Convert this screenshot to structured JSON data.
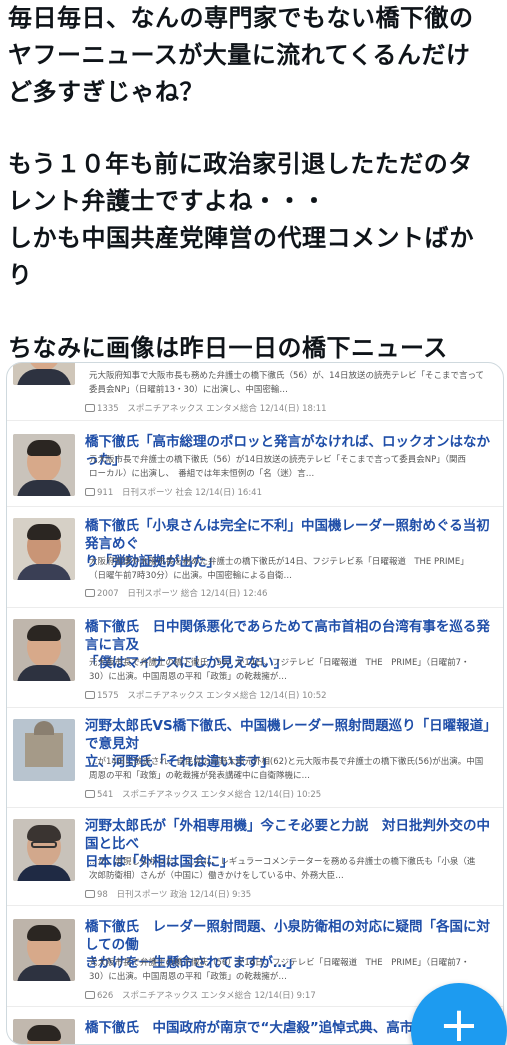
{
  "post": {
    "paragraphs": [
      [
        "毎日毎日、なんの専門家でもない橋下徹の",
        "ヤフーニュースが大量に流れてくるんだけ",
        "ど多すぎじゃね？"
      ],
      [
        "もう１０年も前に政治家引退したただのタ",
        "レント弁護士ですよね・・・",
        "しかも中国共産党陣営の代理コメントばか",
        "り"
      ],
      [
        "ちなみに画像は昨日一日の橋下ニュース"
      ]
    ]
  },
  "news_items": [
    {
      "title": "",
      "snippet": [
        "元大阪府知事で大阪市長も務めた弁護士の橋下徹氏（56）が、14日放送の読売テレビ「そこまで言って",
        "委員会NP」（日曜前13・30）に出演し、中国密輸…"
      ],
      "comments": "1335",
      "source": "スポニチアネックス エンタメ総合 12/14(日) 18:11"
    },
    {
      "title": "橋下徹氏「高市総理のポロッと発言がなければ、ロックオンはなかった」",
      "snippet": [
        "元大阪市長で弁護士の橋下徹氏（56）が14日放送の読売テレビ「そこまで言って委員会NP」（関西",
        "ローカル）に出演し、　番組では年末恒例の「名（迷）言…"
      ],
      "comments": "911",
      "source": "日刊スポーツ 社会 12/14(日) 16:41"
    },
    {
      "title": "橋下徹氏「小泉さんは完全に不利」中国機レーダー照射めぐる当初発言めぐ",
      "title2": "り「弾劾証拠が出た」",
      "snippet": [
        "大阪府知事や大阪市長を務めた弁護士の橋下徹氏が14日、フジテレビ系「日曜報道　THE PRIME」",
        "（日曜午前7時30分）に出演。中国密輸による自衛…"
      ],
      "comments": "2007",
      "source": "日刊スポーツ 総合 12/14(日) 12:46"
    },
    {
      "title": "橋下徹氏　日中関係悪化であらためて高市首相の台湾有事を巡る発言に言及",
      "title2": "「僕はマイナスにしか見えない」",
      "snippet": [
        "元大阪市長で弁護士の橋下徹氏（56）が14日、フジテレビ「日曜報道　THE　PRIME」（日曜前7・",
        "30）に出演。中国周恩の平和「政策」の乾裁擁が…"
      ],
      "comments": "1575",
      "source": "スポニチアネックス エンタメ総合 12/14(日) 10:52"
    },
    {
      "title": "河野太郎氏VS橋下徹氏、中国機レーダー照射問題巡り「日曜報道」で意見対",
      "title2": "立、河野氏「それは違います」",
      "snippet": [
        "…が14日に放送され、自民党の河野太郎元外相(62)と元大阪市長で弁護士の橋下徹氏(56)が出演。中国",
        "周恩の平和「政策」の乾裁擁が発表講確中に自衛隊機に…"
      ],
      "comments": "541",
      "source": "スポニチアネックス エンタメ総合 12/14(日) 10:25"
    },
    {
      "title": "河野太郎氏が「外相専用機」今こそ必要と力説　対日批判外交の中国と比べ",
      "title2": "日本は「外相は国会に」",
      "snippet": [
        "…が、実現しなかった。　これに、レギュラーコメンテーターを務める弁護士の橋下徹氏も「小泉（進",
        "次郎防衛相）さんが（中国に）働きかけをしている中、外務大臣…"
      ],
      "comments": "98",
      "source": "日刊スポーツ 政治 12/14(日) 9:35"
    },
    {
      "title": "橋下徹氏　レーダー照射問題、小泉防衛相の対応に疑問「各国に対しての働",
      "title2": "きかけを一生懸命されてますが…」",
      "snippet": [
        "元大阪市長で弁護士の橋下徹氏（56）が14日、フジテレビ「日曜報道　THE　PRIME」（日曜前7・",
        "30）に出演。中国周恩の平和「政策」の乾裁擁が…"
      ],
      "comments": "626",
      "source": "スポニチアネックス エンタメ総合 12/14(日) 9:17"
    },
    {
      "title": "橋下徹氏　中国政府が南京で“大虐殺”追悼式典、高市政権を",
      "title2": "",
      "snippet": [],
      "comments": "",
      "source": ""
    }
  ],
  "fab": {
    "label": "+"
  },
  "colors": {
    "accent": "#1d9bf0",
    "news_title": "#1f4ea8"
  }
}
